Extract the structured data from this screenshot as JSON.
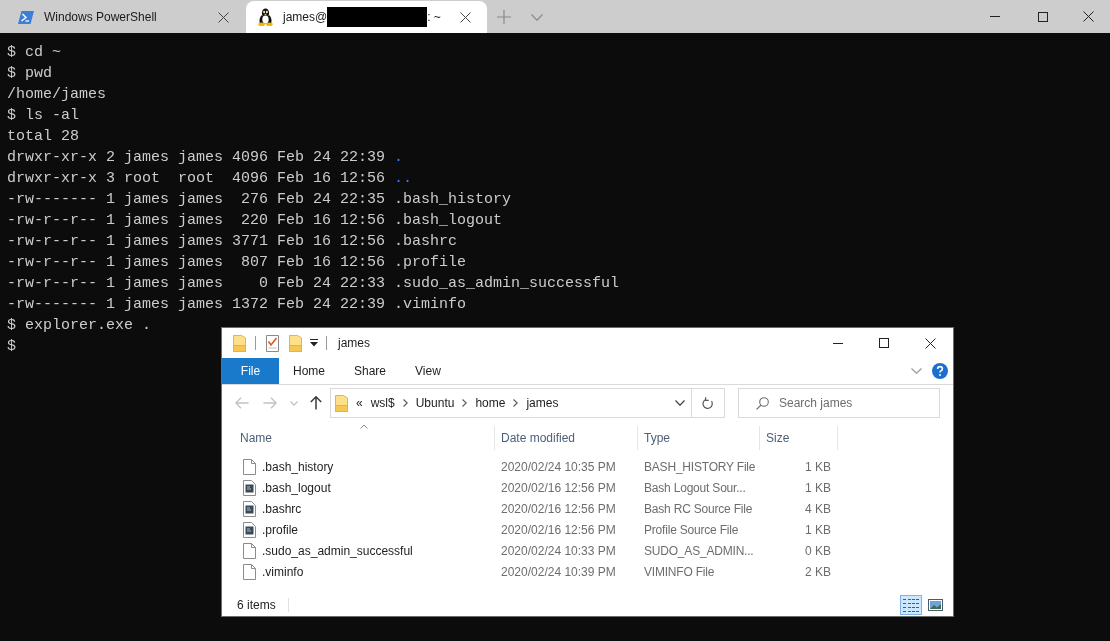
{
  "terminal": {
    "tabs": [
      {
        "kind": "powershell",
        "title": "Windows PowerShell",
        "selected": false,
        "redacted": false
      },
      {
        "kind": "linux",
        "title": "james@",
        "title_tail": ": ~",
        "selected": true,
        "redacted": true
      }
    ],
    "lines": [
      {
        "kind": "text",
        "text": "$ cd ~"
      },
      {
        "kind": "text",
        "text": "$ pwd"
      },
      {
        "kind": "text",
        "text": "/home/james"
      },
      {
        "kind": "text",
        "text": "$ ls -al"
      },
      {
        "kind": "text",
        "text": "total 28"
      },
      {
        "kind": "entry",
        "info": "drwxr-xr-x 2 james james 4096 Feb 24 22:39",
        "name": ".",
        "directory": true
      },
      {
        "kind": "entry",
        "info": "drwxr-xr-x 3 root  root  4096 Feb 16 12:56",
        "name": "..",
        "directory": true
      },
      {
        "kind": "entry",
        "info": "-rw------- 1 james james  276 Feb 24 22:35",
        "name": ".bash_history",
        "directory": false
      },
      {
        "kind": "entry",
        "info": "-rw-r--r-- 1 james james  220 Feb 16 12:56",
        "name": ".bash_logout",
        "directory": false
      },
      {
        "kind": "entry",
        "info": "-rw-r--r-- 1 james james 3771 Feb 16 12:56",
        "name": ".bashrc",
        "directory": false
      },
      {
        "kind": "entry",
        "info": "-rw-r--r-- 1 james james  807 Feb 16 12:56",
        "name": ".profile",
        "directory": false
      },
      {
        "kind": "entry",
        "info": "-rw-r--r-- 1 james james    0 Feb 24 22:33",
        "name": ".sudo_as_admin_successful",
        "directory": false
      },
      {
        "kind": "entry",
        "info": "-rw------- 1 james james 1372 Feb 24 22:39",
        "name": ".viminfo",
        "directory": false
      },
      {
        "kind": "text",
        "text": "$ explorer.exe ."
      },
      {
        "kind": "text",
        "text": "$"
      }
    ]
  },
  "explorer": {
    "title": "james",
    "ribbon": [
      {
        "kind": "file",
        "label": "File"
      },
      {
        "kind": "tab",
        "label": "Home"
      },
      {
        "kind": "tab",
        "label": "Share"
      },
      {
        "kind": "tab",
        "label": "View"
      }
    ],
    "nav": [
      {
        "kind": "back",
        "disabled": true
      },
      {
        "kind": "forward",
        "disabled": true
      },
      {
        "kind": "recent",
        "disabled": true
      },
      {
        "kind": "up",
        "disabled": false
      }
    ],
    "address": {
      "overflow": "«",
      "crumbs": [
        "wsl$",
        "Ubuntu",
        "home",
        "james"
      ]
    },
    "search": {
      "placeholder": "Search james"
    },
    "columns": [
      {
        "label": "Name",
        "sorted": true
      },
      {
        "label": "Date modified",
        "sorted": false
      },
      {
        "label": "Type",
        "sorted": false
      },
      {
        "label": "Size",
        "sorted": false
      }
    ],
    "files": [
      {
        "kind": "plain",
        "name": ".bash_history",
        "date": "2020/02/24 10:35 PM",
        "type": "BASH_HISTORY File",
        "size": "1 KB"
      },
      {
        "kind": "script",
        "name": ".bash_logout",
        "date": "2020/02/16 12:56 PM",
        "type": "Bash Logout Sour...",
        "size": "1 KB"
      },
      {
        "kind": "script",
        "name": ".bashrc",
        "date": "2020/02/16 12:56 PM",
        "type": "Bash RC Source File",
        "size": "4 KB"
      },
      {
        "kind": "script",
        "name": ".profile",
        "date": "2020/02/16 12:56 PM",
        "type": "Profile Source File",
        "size": "1 KB"
      },
      {
        "kind": "plain",
        "name": ".sudo_as_admin_successful",
        "date": "2020/02/24 10:33 PM",
        "type": "SUDO_AS_ADMIN...",
        "size": "0 KB"
      },
      {
        "kind": "plain",
        "name": ".viminfo",
        "date": "2020/02/24 10:39 PM",
        "type": "VIMINFO File",
        "size": "2 KB"
      }
    ],
    "status": "6 items",
    "views": [
      {
        "kind": "details",
        "selected": true
      },
      {
        "kind": "large-icons",
        "selected": false
      }
    ]
  }
}
